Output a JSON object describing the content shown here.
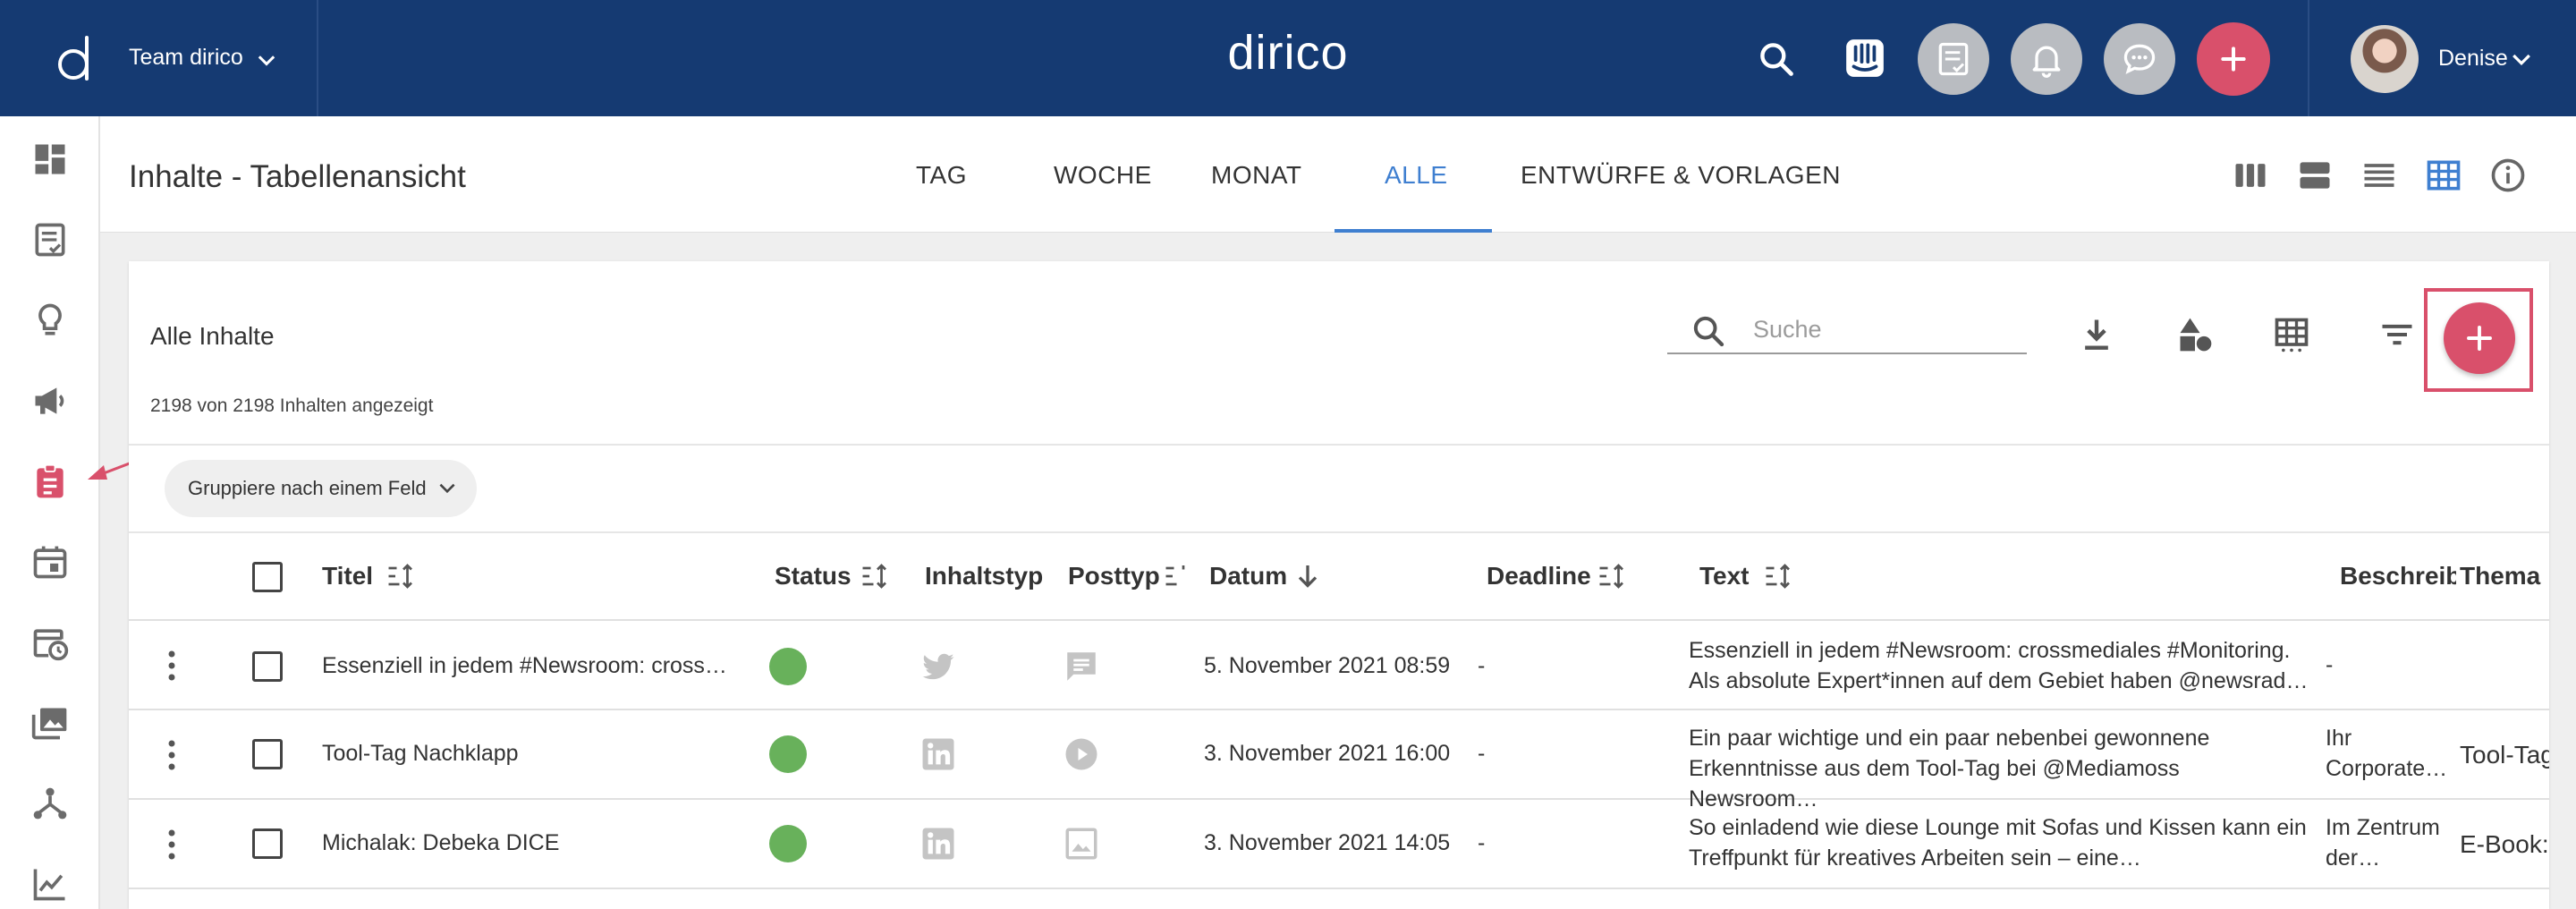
{
  "topbar": {
    "team_name": "Team dirico",
    "brand": "dirico",
    "user_name": "Denise",
    "icons": [
      "search-icon",
      "intercom-icon",
      "task-list-icon",
      "bell-icon",
      "chat-icon",
      "plus-icon"
    ],
    "accent": "#d9506b",
    "bg": "#153a72"
  },
  "sidebar": {
    "items": [
      "dashboard-icon",
      "content-list-icon",
      "idea-bulb-icon",
      "megaphone-icon",
      "clipboard-icon",
      "calendar-icon",
      "calendar-clock-icon",
      "media-library-icon",
      "network-icon",
      "analytics-icon"
    ]
  },
  "subheader": {
    "title": "Inhalte - Tabellenansicht",
    "tabs": [
      {
        "label": "TAG"
      },
      {
        "label": "WOCHE"
      },
      {
        "label": "MONAT"
      },
      {
        "label": "ALLE",
        "active": true
      },
      {
        "label": "ENTWÜRFE & VORLAGEN"
      }
    ],
    "view_icons": [
      "column-view-icon",
      "card-view-icon",
      "list-view-icon",
      "table-view-icon",
      "info-icon"
    ]
  },
  "card": {
    "title": "Alle Inhalte",
    "count_text": "2198 von 2198 Inhalten angezeigt",
    "search_placeholder": "Suche",
    "tools": [
      "download-icon",
      "shapes-icon",
      "table-columns-icon",
      "filter-icon"
    ],
    "group_label": "Gruppiere nach einem Feld"
  },
  "table": {
    "columns": {
      "title": "Titel",
      "status": "Status",
      "content_type": "Inhaltstyp",
      "post_type": "Posttyp",
      "date": "Datum",
      "deadline": "Deadline",
      "text": "Text",
      "description": "Beschreibu",
      "topic": "Thema"
    },
    "rows": [
      {
        "title": "Essenziell in jedem #Newsroom: cross…",
        "status": "green",
        "content_type": "twitter-icon",
        "post_type": "message-icon",
        "date": "5. November 2021 08:59",
        "deadline": "-",
        "text_line1": "Essenziell in jedem #Newsroom: crossmediales #Monitoring.",
        "text_line2": "Als absolute Expert*innen auf dem Gebiet haben @newsrad…",
        "description_line1": "-",
        "description_line2": "",
        "topic": ""
      },
      {
        "title": "Tool-Tag Nachklapp",
        "status": "green",
        "content_type": "linkedin-icon",
        "post_type": "play-icon",
        "date": "3. November 2021 16:00",
        "deadline": "-",
        "text_line1": "Ein paar wichtige und ein paar nebenbei gewonnene",
        "text_line2": "Erkenntnisse aus dem Tool-Tag bei @Mediamoss Newsroom…",
        "description_line1": "Ihr",
        "description_line2": "Corporate…",
        "topic": "Tool-Tag"
      },
      {
        "title": "Michalak: Debeka DICE",
        "status": "green",
        "content_type": "linkedin-icon",
        "post_type": "image-icon",
        "date": "3. November 2021 14:05",
        "deadline": "-",
        "text_line1": "So einladend wie diese Lounge mit Sofas und Kissen kann ein",
        "text_line2": "Treffpunkt für kreatives Arbeiten sein – eine…",
        "description_line1": "Im Zentrum",
        "description_line2": "der…",
        "topic": "E-Book:"
      }
    ]
  },
  "colors": {
    "status_green": "#68b15b",
    "tab_active": "#3f7fd0",
    "icon_grey": "#c4c4c4"
  }
}
